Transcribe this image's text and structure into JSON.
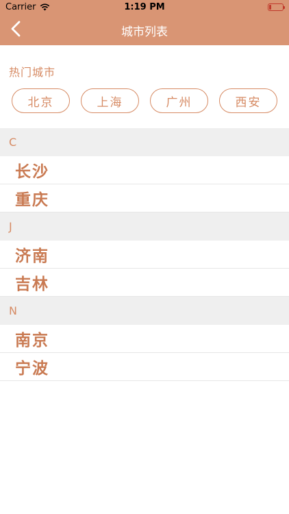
{
  "status_bar": {
    "carrier": "Carrier",
    "time": "1:19 PM"
  },
  "nav": {
    "title": "城市列表",
    "back_icon": "chevron-left-icon"
  },
  "hot_cities": {
    "label": "热门城市",
    "items": [
      "北京",
      "上海",
      "广州",
      "西安"
    ]
  },
  "sections": [
    {
      "letter": "C",
      "cities": [
        "长沙",
        "重庆"
      ]
    },
    {
      "letter": "J",
      "cities": [
        "济南",
        "吉林"
      ]
    },
    {
      "letter": "N",
      "cities": [
        "南京",
        "宁波"
      ]
    }
  ],
  "colors": {
    "accent": "#d99574",
    "text_accent": "#d68a63",
    "section_bg": "#efefef"
  }
}
